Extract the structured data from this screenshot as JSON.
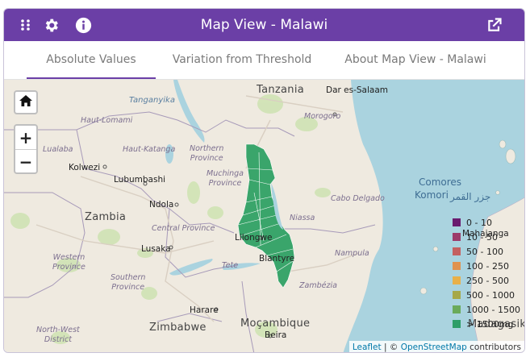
{
  "header": {
    "title": "Map View - Malawi",
    "icons": [
      "grid-icon",
      "gear-icon",
      "info-icon",
      "external-link-icon"
    ]
  },
  "tabs": [
    {
      "label": "Absolute Values",
      "active": true
    },
    {
      "label": "Variation from Threshold",
      "active": false
    },
    {
      "label": "About Map View - Malawi",
      "active": false
    }
  ],
  "map": {
    "controls": {
      "zoom_in": "+",
      "zoom_out": "−",
      "home_icon": "home-icon"
    },
    "labels": {
      "tanzania": "Tanzania",
      "dar": "Dar es-Salaam",
      "zambia": "Zambia",
      "mozambique": "Moçambique",
      "zimbabwe": "Zimbabwe",
      "comores": "Comores",
      "komori": "Komori",
      "komori_ar": "جزر القمر",
      "mahajanga": "Mahajanga",
      "madagasikara": "Madagasikara",
      "tanganyika": "Tanganyika",
      "haut_lomami": "Haut-Lomami",
      "lualaba": "Lualaba",
      "haut_katanga": "Haut-Katanga",
      "kolwezi": "Kolwezi",
      "lubumbashi": "Lubumbashi",
      "northern": "Northern\nProvince",
      "muchinga": "Muchinga\nProvince",
      "ndola": "Ndola",
      "central": "Central Province",
      "western": "Western\nProvince",
      "southern": "Southern\nProvince",
      "lusaka": "Lusaka",
      "harare": "Harare",
      "beira": "Beira",
      "niassa": "Niassa",
      "cabo": "Cabo Delgado",
      "nampula": "Nampula",
      "zambezia": "Zambézia",
      "tete": "Tete",
      "morogoro": "Morogoro",
      "lilongwe": "Lilongwe",
      "blantyre": "Blantyre",
      "northwest": "North-West\nDistrict"
    },
    "attribution": {
      "leaflet": "Leaflet",
      "sep": " | © ",
      "osm": "OpenStreetMap",
      "suffix": " contributors"
    }
  },
  "legend": {
    "items": [
      {
        "label": "0 - 10",
        "color": "#6a1b6f"
      },
      {
        "label": "10 - 50",
        "color": "#9c3a6a"
      },
      {
        "label": "50 - 100",
        "color": "#c46060"
      },
      {
        "label": "100 - 250",
        "color": "#e0924e"
      },
      {
        "label": "250 - 500",
        "color": "#e8b04a"
      },
      {
        "label": "500 - 1000",
        "color": "#a6a848"
      },
      {
        "label": "1000 - 1500",
        "color": "#6aaa5a"
      },
      {
        "label": "> 1500mg",
        "color": "#2e9e68"
      }
    ]
  },
  "colors": {
    "header": "#6b3fa6",
    "water": "#aad3df",
    "malawi": "#3aa56b"
  }
}
